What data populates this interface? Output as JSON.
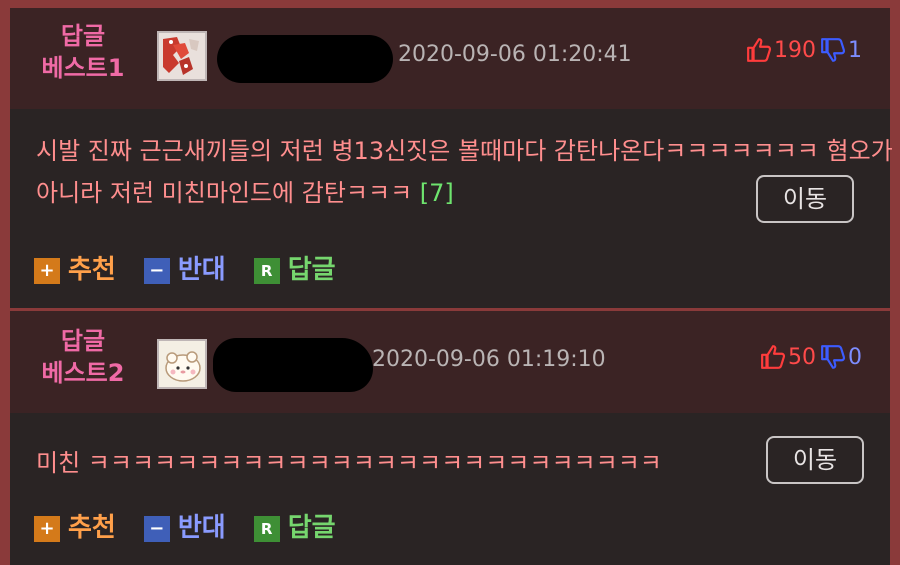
{
  "comments": [
    {
      "best_label": "답글",
      "best_rank": "베스트1",
      "date": "2020-09-06 01:20:41",
      "up_count": "190",
      "down_count": "1",
      "text": "시발 진짜 근근새끼들의 저런 병13신짓은 볼때마다 감탄나온다ㅋㅋㅋㅋㅋㅋㅋ 혐오가 아니라 저런 미친마인드에 감탄ㅋㅋㅋ ",
      "reply_count": "[7]",
      "move_label": "이동",
      "actions": {
        "recommend": "추천",
        "oppose": "반대",
        "reply": "답글"
      }
    },
    {
      "best_label": "답글",
      "best_rank": "베스트2",
      "date": "2020-09-06 01:19:10",
      "up_count": "50",
      "down_count": "0",
      "text": "미친 ㅋㅋㅋㅋㅋㅋㅋㅋㅋㅋㅋㅋㅋㅋㅋㅋㅋㅋㅋㅋㅋㅋㅋㅋㅋㅋ",
      "move_label": "이동",
      "actions": {
        "recommend": "추천",
        "oppose": "반대",
        "reply": "답글"
      }
    }
  ],
  "icons": {
    "recommend_symbol": "+",
    "oppose_symbol": "−",
    "reply_symbol": "R"
  },
  "colors": {
    "best_label": "#f06aa6",
    "comment_text": "#ff8e8e",
    "reply_count": "#6ee46e",
    "up_count": "#ff4a4a",
    "down_count": "#7d8dff"
  }
}
